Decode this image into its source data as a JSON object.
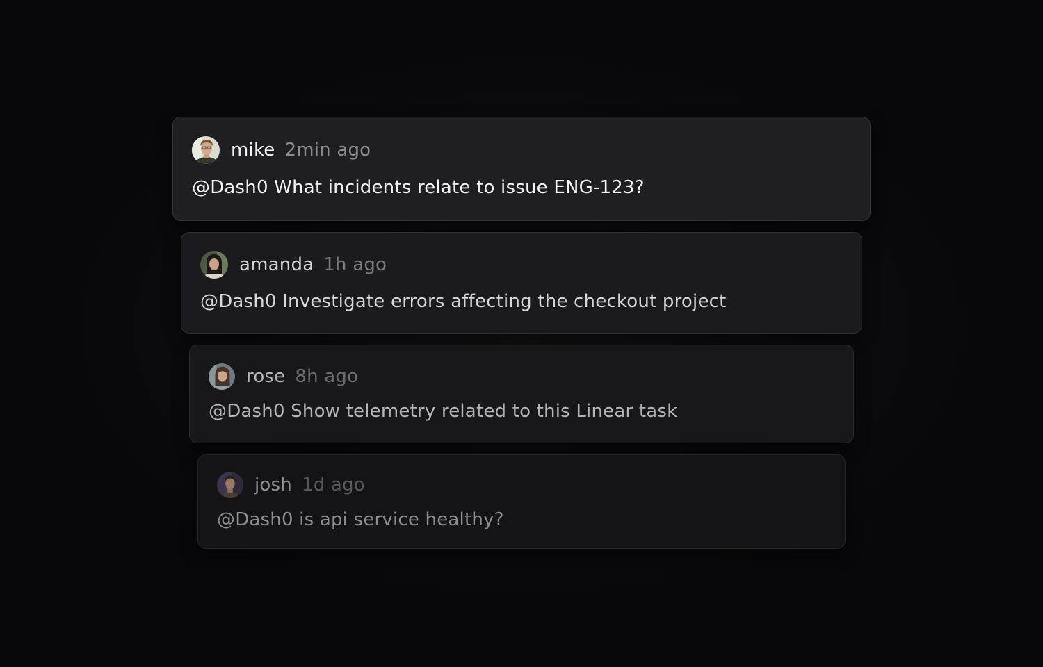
{
  "comments": [
    {
      "user": "mike",
      "time": "2min ago",
      "message": "@Dash0 What incidents relate to issue ENG-123?"
    },
    {
      "user": "amanda",
      "time": "1h ago",
      "message": "@Dash0 Investigate errors affecting the checkout project"
    },
    {
      "user": "rose",
      "time": "8h ago",
      "message": "@Dash0 Show telemetry related to this Linear task"
    },
    {
      "user": "josh",
      "time": "1d ago",
      "message": "@Dash0 is api service healthy?"
    }
  ]
}
